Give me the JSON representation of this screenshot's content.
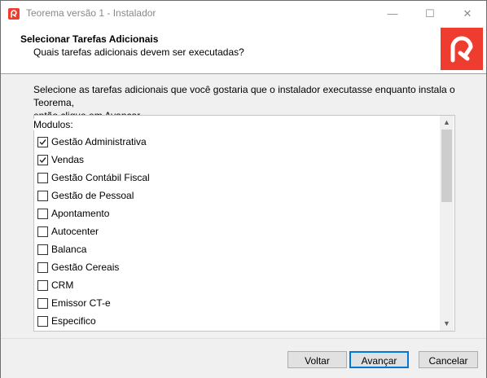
{
  "window": {
    "title": "Teorema versão 1 - Instalador",
    "controls": [
      "—",
      "☐",
      "✕"
    ]
  },
  "header": {
    "title": "Selecionar Tarefas Adicionais",
    "subtitle": "Quais tarefas adicionais devem ser executadas?"
  },
  "main": {
    "description_line1": "Selecione as tarefas adicionais que você gostaria que o instalador executasse enquanto instala o Teorema,",
    "description_line2": "então clique em Avançar.",
    "list_label": "Modulos:",
    "items": [
      {
        "label": "Gestão Administrativa",
        "checked": true
      },
      {
        "label": "Vendas",
        "checked": true
      },
      {
        "label": "Gestão Contábil Fiscal",
        "checked": false
      },
      {
        "label": "Gestão de Pessoal",
        "checked": false
      },
      {
        "label": "Apontamento",
        "checked": false
      },
      {
        "label": "Autocenter",
        "checked": false
      },
      {
        "label": "Balanca",
        "checked": false
      },
      {
        "label": "Gestão Cereais",
        "checked": false
      },
      {
        "label": "CRM",
        "checked": false
      },
      {
        "label": "Emissor CT-e",
        "checked": false
      },
      {
        "label": "Especifico",
        "checked": false
      }
    ]
  },
  "footer": {
    "back": "Voltar",
    "next": "Avançar",
    "cancel": "Cancelar"
  },
  "colors": {
    "brand": "#ee3d2f",
    "accent": "#0078d7"
  }
}
